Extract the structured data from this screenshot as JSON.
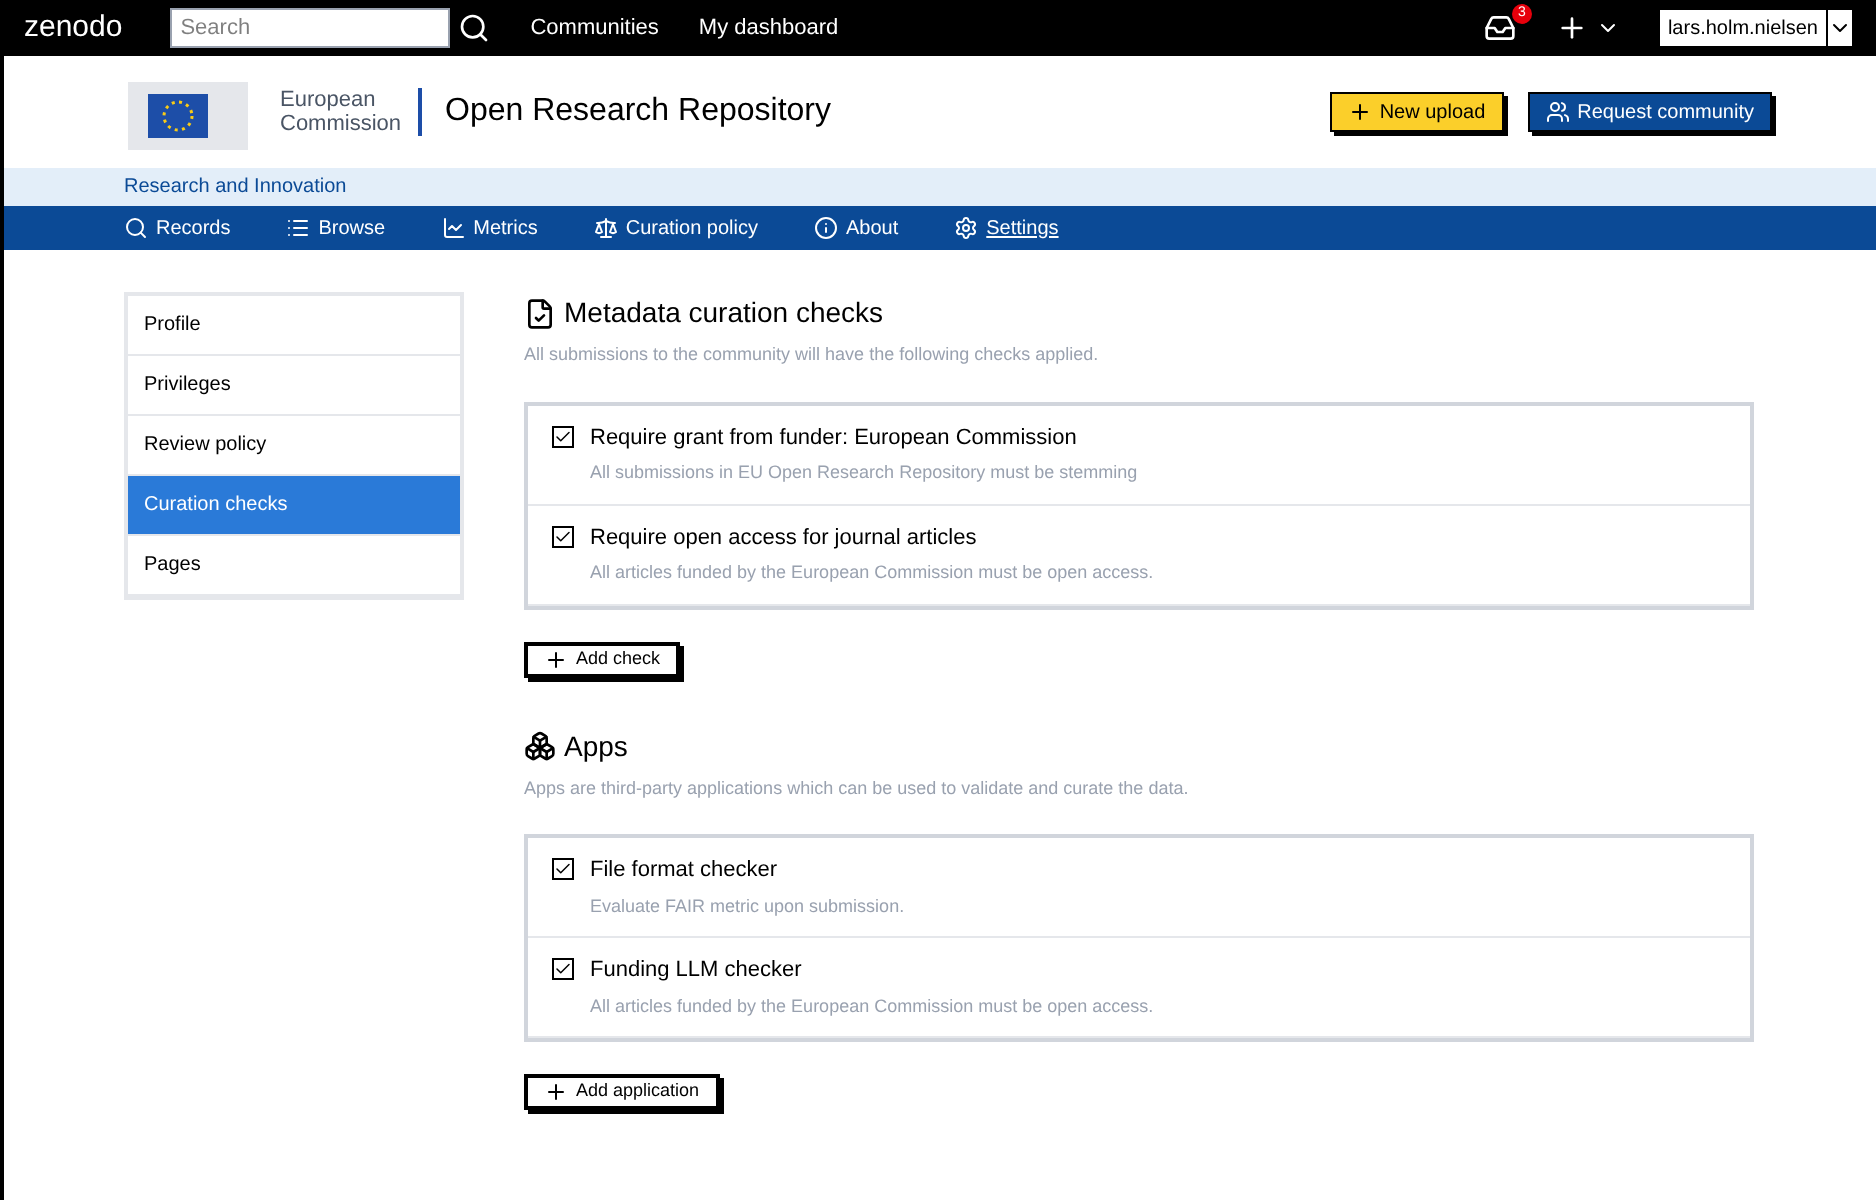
{
  "topbar": {
    "logo": "zenodo",
    "search": {
      "placeholder": "Search"
    },
    "links": [
      "Communities",
      "My dashboard"
    ],
    "inbox_badge": "3",
    "user": "lars.holm.nielsen"
  },
  "header": {
    "logo_text": [
      "European",
      "Commission"
    ],
    "title": "Open Research Repository",
    "buttons": [
      {
        "label": "New upload",
        "kind": "upload"
      },
      {
        "label": "Request community",
        "kind": "community"
      }
    ]
  },
  "subbar": {
    "label": "Research and Innovation"
  },
  "nav": [
    {
      "label": "Records",
      "kind": "search",
      "selected": false
    },
    {
      "label": "Browse",
      "kind": "list",
      "selected": false
    },
    {
      "label": "Metrics",
      "kind": "chart",
      "selected": false
    },
    {
      "label": "Curation policy",
      "kind": "scale",
      "selected": false
    },
    {
      "label": "About",
      "kind": "info",
      "selected": false
    },
    {
      "label": "Settings",
      "kind": "gear",
      "selected": true
    }
  ],
  "sidebar": [
    {
      "label": "Profile",
      "selected": false
    },
    {
      "label": "Privileges",
      "selected": false
    },
    {
      "label": "Review policy",
      "selected": false
    },
    {
      "label": "Curation checks",
      "selected": true
    },
    {
      "label": "Pages",
      "selected": false
    }
  ],
  "sections": [
    {
      "kind": "checks",
      "title": "Metadata curation checks",
      "description": "All submissions to the community will have the following checks applied.",
      "items": [
        {
          "title": "Require grant from funder: European Commission",
          "description": "All submissions in EU Open Research Repository must be stemming",
          "checked": true
        },
        {
          "title": "Require open access for journal articles",
          "description": "All articles funded by the European Commission must be open access.",
          "checked": true
        }
      ],
      "button": "Add check"
    },
    {
      "kind": "apps",
      "title": "Apps",
      "description": "Apps are third-party applications which can be used to validate and curate the data.",
      "items": [
        {
          "title": "File format checker",
          "description": "Evaluate FAIR metric upon submission.",
          "checked": true
        },
        {
          "title": "Funding LLM checker",
          "description": "All articles funded by the European Commission must be open access.",
          "checked": true
        }
      ],
      "button": "Add application"
    }
  ]
}
